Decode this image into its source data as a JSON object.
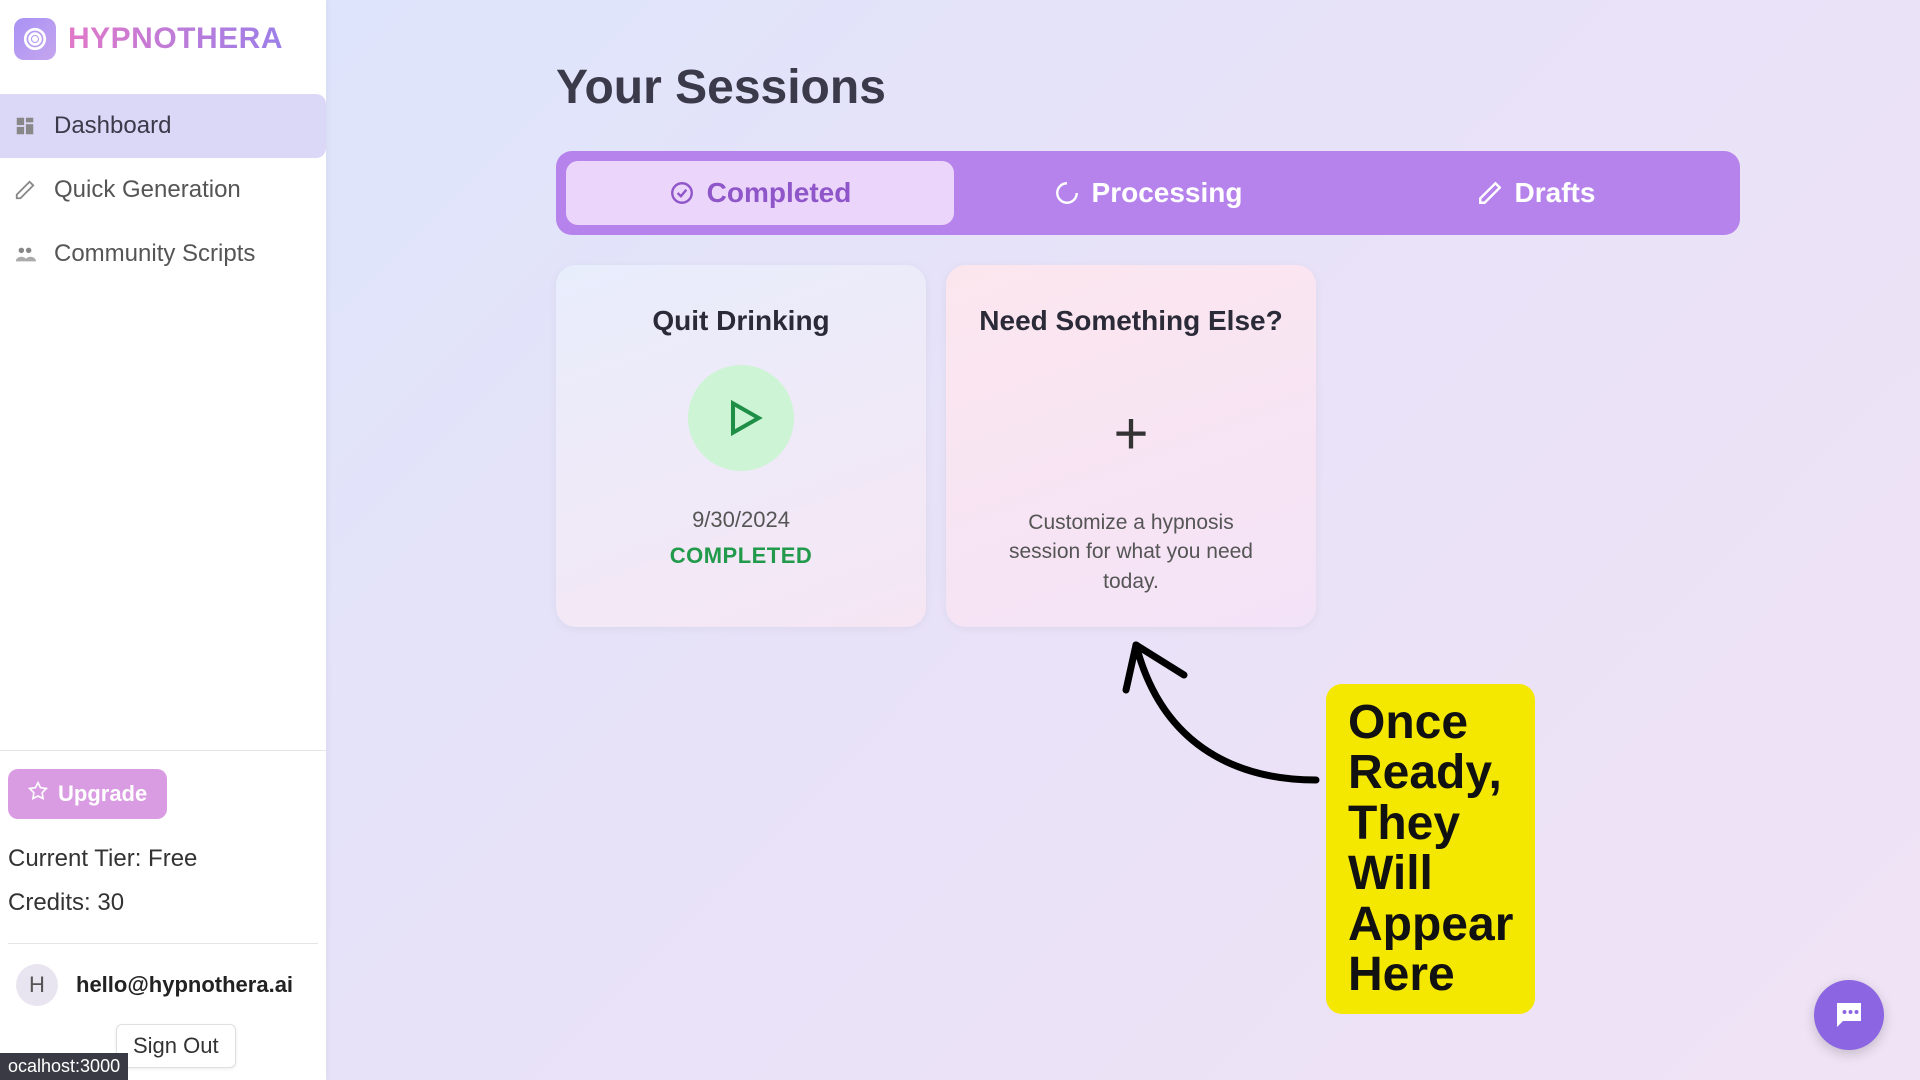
{
  "brand": {
    "name": "HYPNOTHERA"
  },
  "sidebar": {
    "nav": [
      {
        "label": "Dashboard",
        "active": true,
        "icon": "dashboard"
      },
      {
        "label": "Quick Generation",
        "active": false,
        "icon": "pencil"
      },
      {
        "label": "Community Scripts",
        "active": false,
        "icon": "people"
      }
    ],
    "upgrade_label": "Upgrade",
    "tier_label": "Current Tier: Free",
    "credits_label": "Credits: 30"
  },
  "account": {
    "initial": "H",
    "email": "hello@hypnothera.ai",
    "signout_label": "Sign Out"
  },
  "page": {
    "title": "Your Sessions"
  },
  "tabs": [
    {
      "label": "Completed",
      "active": true,
      "icon": "check-circle"
    },
    {
      "label": "Processing",
      "active": false,
      "icon": "spinner"
    },
    {
      "label": "Drafts",
      "active": false,
      "icon": "pencil"
    }
  ],
  "session_card": {
    "title": "Quit Drinking",
    "date": "9/30/2024",
    "status": "COMPLETED"
  },
  "new_card": {
    "title": "Need Something Else?",
    "description": "Customize a hypnosis session for what you need today."
  },
  "annotation": {
    "text": "Once Ready,\nThey Will\nAppear Here"
  },
  "status_bar": "ocalhost:3000"
}
